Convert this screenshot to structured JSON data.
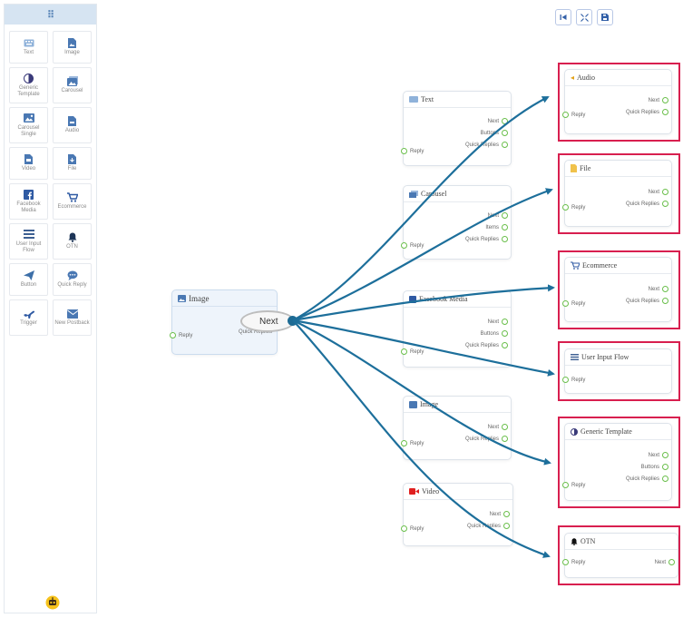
{
  "sidebar": {
    "tools": [
      {
        "label": "Text",
        "icon": "keyboard-icon",
        "color": "#8fb2da"
      },
      {
        "label": "Image",
        "icon": "image-icon",
        "color": "#4a78b3"
      },
      {
        "label": "Generic Template",
        "icon": "half-circle-icon",
        "color": "#3a3a7a"
      },
      {
        "label": "Carousel",
        "icon": "carousel-icon",
        "color": "#4a78b3"
      },
      {
        "label": "Carousel Single",
        "icon": "picture-icon",
        "color": "#4a78b3"
      },
      {
        "label": "Audio",
        "icon": "audio-file-icon",
        "color": "#4a78b3"
      },
      {
        "label": "Video",
        "icon": "video-file-icon",
        "color": "#4a78b3"
      },
      {
        "label": "File",
        "icon": "file-icon",
        "color": "#4a78b3"
      },
      {
        "label": "Facebook Media",
        "icon": "facebook-icon",
        "color": "#2f5aa3"
      },
      {
        "label": "Ecommerce",
        "icon": "cart-icon",
        "color": "#2f5aa3"
      },
      {
        "label": "User Input Flow",
        "icon": "list-icon",
        "color": "#3d5f92"
      },
      {
        "label": "OTN",
        "icon": "bell-icon",
        "color": "#1d3557"
      },
      {
        "label": "Button",
        "icon": "send-icon",
        "color": "#3d6fa8"
      },
      {
        "label": "Quick Reply",
        "icon": "chat-icon",
        "color": "#4a78b3"
      },
      {
        "label": "Trigger",
        "icon": "plane-icon",
        "color": "#2f5aa3"
      },
      {
        "label": "New Postback",
        "icon": "envelope-icon",
        "color": "#4a78b3"
      }
    ]
  },
  "source_node": {
    "title": "Image",
    "reply": "Reply",
    "next": "Next",
    "quick_replies": "Quick Replies"
  },
  "middle_nodes": {
    "text": {
      "title": "Text",
      "next": "Next",
      "buttons": "Buttons",
      "quick_replies": "Quick Replies",
      "reply": "Reply"
    },
    "carousel": {
      "title": "Carousel",
      "next": "Next",
      "items": "Items",
      "quick_replies": "Quick Replies",
      "reply": "Reply"
    },
    "facebook_media": {
      "title": "Facebook Media",
      "next": "Next",
      "buttons": "Buttons",
      "quick_replies": "Quick Replies",
      "reply": "Reply"
    },
    "image": {
      "title": "Image",
      "next": "Next",
      "quick_replies": "Quick Replies",
      "reply": "Reply"
    },
    "video": {
      "title": "Video",
      "next": "Next",
      "quick_replies": "Quick Replies",
      "reply": "Reply"
    }
  },
  "target_nodes": {
    "audio": {
      "title": "Audio",
      "next": "Next",
      "quick_replies": "Quick Replies",
      "reply": "Reply"
    },
    "file": {
      "title": "File",
      "next": "Next",
      "quick_replies": "Quick Replies",
      "reply": "Reply"
    },
    "ecommerce": {
      "title": "Ecommerce",
      "next": "Next",
      "quick_replies": "Quick Replies",
      "reply": "Reply"
    },
    "user_input_flow": {
      "title": "User Input Flow",
      "reply": "Reply"
    },
    "generic_template": {
      "title": "Generic Template",
      "next": "Next",
      "buttons": "Buttons",
      "quick_replies": "Quick Replies",
      "reply": "Reply"
    },
    "otn": {
      "title": "OTN",
      "reply": "Reply",
      "next": "Next"
    }
  },
  "colors": {
    "edge": "#1d6f9b",
    "highlight": "#d81f4f",
    "port": "#6abf4b"
  }
}
